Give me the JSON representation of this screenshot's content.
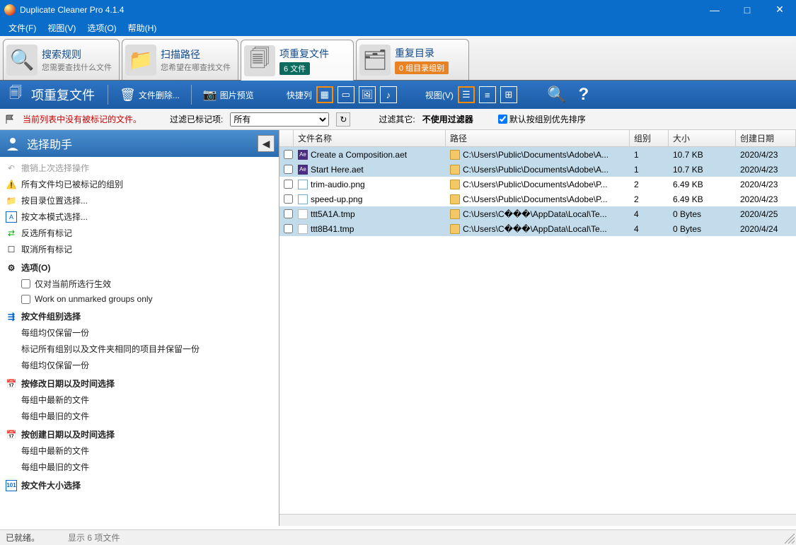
{
  "window": {
    "title": "Duplicate Cleaner Pro 4.1.4"
  },
  "menu": {
    "file": "文件(F)",
    "view": "视图(V)",
    "options": "选项(O)",
    "help": "帮助(H)"
  },
  "tabs": {
    "search_rules": {
      "title": "搜索规则",
      "sub": "您需要查找什么文件"
    },
    "scan_path": {
      "title": "扫描路径",
      "sub": "您希望在哪查找文件"
    },
    "dup_files": {
      "title": "项重复文件",
      "badge": "6 文件"
    },
    "dup_dirs": {
      "title": "重复目录",
      "badge": "0 组目录组别"
    }
  },
  "toolbar": {
    "title": "项重复文件",
    "delete": "文件删除...",
    "preview": "图片预览",
    "quick_cols": "快捷列",
    "view_label": "视图(V)"
  },
  "filterbar": {
    "status": "当前列表中没有被标记的文件。",
    "filter_marked_label": "过滤已标记项:",
    "filter_all": "所有",
    "filter_other_label": "过滤其它:",
    "filter_none": "不使用过滤器",
    "default_sort": "默认按组别优先排序"
  },
  "sidebar": {
    "title": "选择助手",
    "undo": "撤销上次选择操作",
    "all_marked": "所有文件均已被标记的组别",
    "by_location": "按目录位置选择...",
    "by_pattern": "按文本模式选择...",
    "invert": "反选所有标记",
    "unmark": "取消所有标记",
    "options_header": "选项(O)",
    "opt_selected_only": "仅对当前所选行生效",
    "opt_unmarked_only": "Work on unmarked groups only",
    "group_header": "按文件组别选择",
    "group_keep_one": "每组均仅保留一份",
    "group_mark_all": "标记所有组别以及文件夹相同的项目并保留一份",
    "group_keep_one2": "每组均仅保留一份",
    "mdate_header": "按修改日期以及时间选择",
    "mdate_newest": "每组中最新的文件",
    "mdate_oldest": "每组中最旧的文件",
    "cdate_header": "按创建日期以及时间选择",
    "cdate_newest": "每组中最新的文件",
    "cdate_oldest": "每组中最旧的文件",
    "size_header": "按文件大小选择"
  },
  "columns": {
    "name": "文件名称",
    "path": "路径",
    "group": "组别",
    "size": "大小",
    "created": "创建日期"
  },
  "rows": [
    {
      "name": "Create a Composition.aet",
      "path": "C:\\Users\\Public\\Documents\\Adobe\\A...",
      "group": "1",
      "size": "10.7 KB",
      "date": "2020/4/23",
      "icon": "ae",
      "grp": "a"
    },
    {
      "name": "Start Here.aet",
      "path": "C:\\Users\\Public\\Documents\\Adobe\\A...",
      "group": "1",
      "size": "10.7 KB",
      "date": "2020/4/23",
      "icon": "ae",
      "grp": "a"
    },
    {
      "name": "trim-audio.png",
      "path": "C:\\Users\\Public\\Documents\\Adobe\\P...",
      "group": "2",
      "size": "6.49 KB",
      "date": "2020/4/23",
      "icon": "png",
      "grp": "b"
    },
    {
      "name": "speed-up.png",
      "path": "C:\\Users\\Public\\Documents\\Adobe\\P...",
      "group": "2",
      "size": "6.49 KB",
      "date": "2020/4/23",
      "icon": "png",
      "grp": "b"
    },
    {
      "name": "ttt5A1A.tmp",
      "path": "C:\\Users\\C���\\AppData\\Local\\Te...",
      "group": "4",
      "size": "0 Bytes",
      "date": "2020/4/25",
      "icon": "file",
      "grp": "a"
    },
    {
      "name": "ttt8B41.tmp",
      "path": "C:\\Users\\C���\\AppData\\Local\\Te...",
      "group": "4",
      "size": "0 Bytes",
      "date": "2020/4/24",
      "icon": "file",
      "grp": "a"
    }
  ],
  "status": {
    "ready": "已就绪。",
    "count": "显示 6 项文件"
  }
}
